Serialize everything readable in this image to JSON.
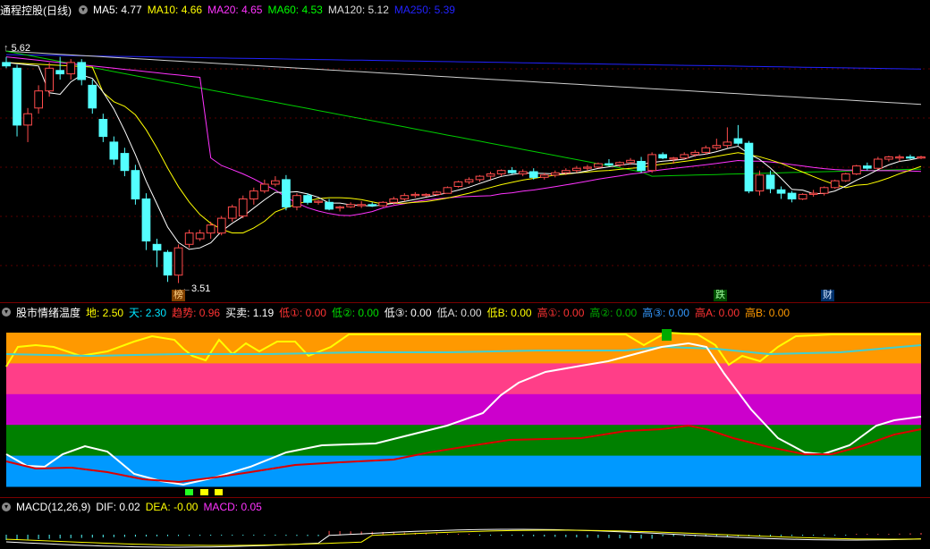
{
  "main": {
    "title": "通程控股(日线)",
    "ma": [
      {
        "label": "MA5: 4.77",
        "color": "#ffffff"
      },
      {
        "label": "MA10: 4.66",
        "color": "#ffff00"
      },
      {
        "label": "MA20: 4.65",
        "color": "#ff33ff"
      },
      {
        "label": "MA60: 4.53",
        "color": "#00ff00"
      },
      {
        "label": "MA120: 5.12",
        "color": "#dddddd"
      },
      {
        "label": "MA250: 5.39",
        "color": "#2222ff"
      }
    ],
    "high_label": "5.62",
    "low_label": "3.51",
    "markers": {
      "bang": "榜",
      "die": "跌",
      "cai": "财"
    },
    "colors": {
      "up": "#ff4c4c",
      "down": "#54ffff"
    },
    "candles": [
      [
        5.45,
        5.5,
        5.4,
        5.42
      ],
      [
        5.4,
        5.43,
        4.8,
        4.9
      ],
      [
        4.9,
        5.05,
        4.75,
        5.0
      ],
      [
        5.05,
        5.25,
        5.0,
        5.2
      ],
      [
        5.2,
        5.45,
        5.15,
        5.4
      ],
      [
        5.38,
        5.5,
        5.3,
        5.35
      ],
      [
        5.35,
        5.48,
        5.3,
        5.45
      ],
      [
        5.45,
        5.48,
        5.25,
        5.3
      ],
      [
        5.25,
        5.3,
        5.0,
        5.05
      ],
      [
        4.95,
        5.0,
        4.75,
        4.8
      ],
      [
        4.75,
        4.8,
        4.55,
        4.6
      ],
      [
        4.65,
        4.7,
        4.45,
        4.5
      ],
      [
        4.5,
        4.55,
        4.2,
        4.25
      ],
      [
        4.25,
        4.3,
        3.8,
        3.88
      ],
      [
        3.85,
        3.9,
        3.65,
        3.8
      ],
      [
        3.78,
        3.8,
        3.52,
        3.58
      ],
      [
        3.58,
        3.85,
        3.51,
        3.82
      ],
      [
        3.85,
        3.98,
        3.82,
        3.95
      ],
      [
        3.9,
        3.98,
        3.88,
        3.95
      ],
      [
        3.95,
        4.05,
        3.9,
        4.02
      ],
      [
        3.95,
        4.1,
        3.93,
        4.08
      ],
      [
        4.08,
        4.2,
        4.05,
        4.18
      ],
      [
        4.1,
        4.28,
        4.08,
        4.25
      ],
      [
        4.25,
        4.35,
        4.2,
        4.32
      ],
      [
        4.32,
        4.42,
        4.3,
        4.38
      ],
      [
        4.38,
        4.45,
        4.36,
        4.41
      ],
      [
        4.42,
        4.46,
        4.15,
        4.18
      ],
      [
        4.18,
        4.3,
        4.15,
        4.28
      ],
      [
        4.28,
        4.3,
        4.2,
        4.22
      ],
      [
        4.22,
        4.24,
        4.2,
        4.23
      ],
      [
        4.22,
        4.25,
        4.15,
        4.16
      ],
      [
        4.17,
        4.19,
        4.14,
        4.18
      ],
      [
        4.18,
        4.22,
        4.17,
        4.2
      ],
      [
        4.19,
        4.23,
        4.17,
        4.2
      ],
      [
        4.2,
        4.22,
        4.18,
        4.19
      ],
      [
        4.19,
        4.23,
        4.18,
        4.22
      ],
      [
        4.22,
        4.27,
        4.2,
        4.25
      ],
      [
        4.25,
        4.3,
        4.23,
        4.28
      ],
      [
        4.28,
        4.31,
        4.26,
        4.29
      ],
      [
        4.28,
        4.3,
        4.27,
        4.29
      ],
      [
        4.29,
        4.32,
        4.28,
        4.31
      ],
      [
        4.3,
        4.36,
        4.3,
        4.35
      ],
      [
        4.36,
        4.41,
        4.35,
        4.4
      ],
      [
        4.4,
        4.44,
        4.38,
        4.42
      ],
      [
        4.42,
        4.46,
        4.4,
        4.45
      ],
      [
        4.45,
        4.49,
        4.42,
        4.47
      ],
      [
        4.47,
        4.51,
        4.45,
        4.5
      ],
      [
        4.5,
        4.53,
        4.47,
        4.48
      ],
      [
        4.47,
        4.51,
        4.45,
        4.49
      ],
      [
        4.49,
        4.52,
        4.42,
        4.44
      ],
      [
        4.44,
        4.48,
        4.42,
        4.46
      ],
      [
        4.46,
        4.5,
        4.44,
        4.48
      ],
      [
        4.48,
        4.52,
        4.46,
        4.5
      ],
      [
        4.5,
        4.54,
        4.48,
        4.52
      ],
      [
        4.52,
        4.55,
        4.5,
        4.53
      ],
      [
        4.53,
        4.57,
        4.52,
        4.56
      ],
      [
        4.56,
        4.6,
        4.54,
        4.55
      ],
      [
        4.55,
        4.58,
        4.53,
        4.57
      ],
      [
        4.57,
        4.61,
        4.55,
        4.59
      ],
      [
        4.58,
        4.62,
        4.48,
        4.5
      ],
      [
        4.5,
        4.66,
        4.48,
        4.64
      ],
      [
        4.64,
        4.66,
        4.6,
        4.61
      ],
      [
        4.6,
        4.62,
        4.56,
        4.61
      ],
      [
        4.61,
        4.66,
        4.6,
        4.64
      ],
      [
        4.64,
        4.68,
        4.62,
        4.66
      ],
      [
        4.66,
        4.72,
        4.64,
        4.7
      ],
      [
        4.7,
        4.78,
        4.68,
        4.72
      ],
      [
        4.72,
        4.88,
        4.7,
        4.75
      ],
      [
        4.78,
        4.9,
        4.72,
        4.74
      ],
      [
        4.74,
        4.76,
        4.3,
        4.32
      ],
      [
        4.32,
        4.5,
        4.28,
        4.46
      ],
      [
        4.46,
        4.5,
        4.3,
        4.34
      ],
      [
        4.33,
        4.36,
        4.25,
        4.3
      ],
      [
        4.3,
        4.32,
        4.22,
        4.25
      ],
      [
        4.25,
        4.3,
        4.24,
        4.29
      ],
      [
        4.29,
        4.33,
        4.27,
        4.3
      ],
      [
        4.3,
        4.36,
        4.28,
        4.35
      ],
      [
        4.35,
        4.42,
        4.34,
        4.41
      ],
      [
        4.41,
        4.48,
        4.4,
        4.47
      ],
      [
        4.47,
        4.55,
        4.46,
        4.54
      ],
      [
        4.54,
        4.57,
        4.5,
        4.52
      ],
      [
        4.52,
        4.62,
        4.51,
        4.6
      ],
      [
        4.6,
        4.63,
        4.58,
        4.62
      ],
      [
        4.61,
        4.64,
        4.58,
        4.62
      ],
      [
        4.62,
        4.64,
        4.6,
        4.61
      ],
      [
        4.61,
        4.63,
        4.6,
        4.62
      ]
    ]
  },
  "mood": {
    "title": "股市情绪温度",
    "items": [
      {
        "label": "地: 2.50",
        "color": "#ffff00"
      },
      {
        "label": "天: 2.30",
        "color": "#00e5ff"
      },
      {
        "label": "趋势: 0.96",
        "color": "#ff3333"
      },
      {
        "label": "买卖: 1.19",
        "color": "#ffffff"
      },
      {
        "label": "低①: 0.00",
        "color": "#ff3333"
      },
      {
        "label": "低②: 0.00",
        "color": "#00dd00"
      },
      {
        "label": "低③: 0.00",
        "color": "#ffffff"
      },
      {
        "label": "低A: 0.00",
        "color": "#dddddd"
      },
      {
        "label": "低B: 0.00",
        "color": "#ffff00"
      },
      {
        "label": "高①: 0.00",
        "color": "#ff3333"
      },
      {
        "label": "高②: 0.00",
        "color": "#00aa00"
      },
      {
        "label": "高③: 0.00",
        "color": "#3399ff"
      },
      {
        "label": "高A: 0.00",
        "color": "#ff3333"
      },
      {
        "label": "高B: 0.00",
        "color": "#ff9900"
      }
    ],
    "bands": [
      "#ff9900",
      "#ff3e88",
      "#cc00cc",
      "#008000",
      "#0099ff"
    ]
  },
  "macd": {
    "title": "MACD(12,26,9)",
    "items": [
      {
        "label": "DIF: 0.02",
        "color": "#ffffff"
      },
      {
        "label": "DEA: -0.00",
        "color": "#ffff00"
      },
      {
        "label": "MACD: 0.05",
        "color": "#ff33ff"
      }
    ]
  }
}
